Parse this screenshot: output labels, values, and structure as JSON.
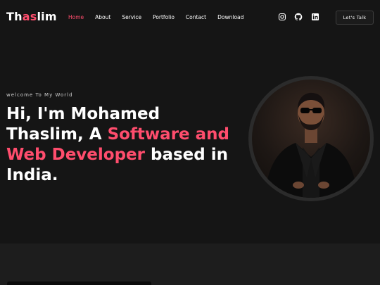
{
  "header": {
    "logo": {
      "part1": "Th",
      "part2": "as",
      "part3": "lim"
    },
    "nav": [
      {
        "label": "Home",
        "active": true
      },
      {
        "label": "About",
        "active": false
      },
      {
        "label": "Service",
        "active": false
      },
      {
        "label": "Portfolio",
        "active": false
      },
      {
        "label": "Contact",
        "active": false
      },
      {
        "label": "Download",
        "active": false
      }
    ],
    "social": [
      "instagram-icon",
      "github-icon",
      "linkedin-icon"
    ],
    "cta_label": "Let's Talk"
  },
  "hero": {
    "welcome": "welcome To My World",
    "headline_part1": "Hi, I'm Mohamed Thaslim, A ",
    "headline_accent": "Software and Web Developer",
    "headline_part2": " based in India."
  },
  "colors": {
    "accent": "#ff4d6d",
    "background": "#151515",
    "section_alt": "#1d1d1d"
  }
}
